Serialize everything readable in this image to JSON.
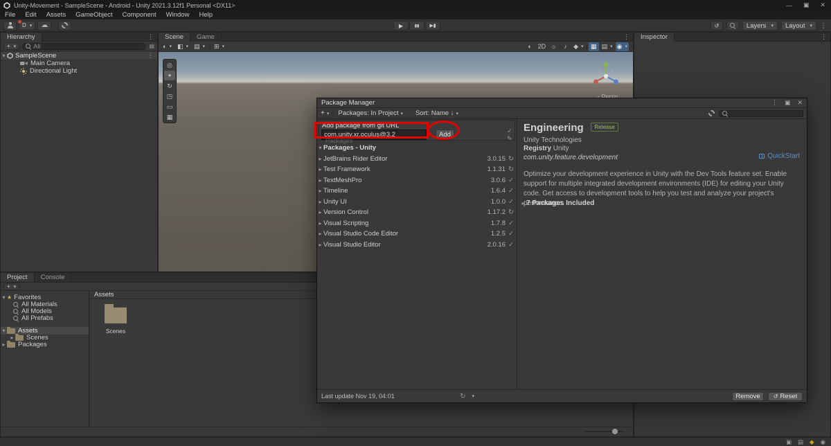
{
  "colors": {
    "annotation_red": "#e40000",
    "link_blue": "#5a8fc7",
    "release_green": "#9cc069",
    "panel_bg": "#383838",
    "chrome_dark": "#191919"
  },
  "icons": {
    "caret_down": "▾",
    "fold_open": "▾",
    "fold_closed": "▸",
    "check": "✓",
    "update": "↻",
    "close": "✕",
    "more": "⋮",
    "menu": "≡",
    "minimize": "—",
    "maximize": "▣",
    "play": "▶",
    "pause": "▮▮",
    "step": "▶▮",
    "undo_history": "↺",
    "refresh": "↻",
    "star": "★",
    "cloud": "☁",
    "plus": "+",
    "back": "‹",
    "pen": "✎",
    "sphere": "◐",
    "half": "◧",
    "rows": "▤",
    "grid": "▦",
    "grid2": "⊞",
    "light": "☼",
    "audio": "♪",
    "fx": "◆",
    "gizmo": "◉"
  },
  "title_bar": {
    "title": "Unity-Movement - SampleScene - Android - Unity 2021.3.12f1 Personal <DX11>"
  },
  "menu_bar": {
    "items": [
      "File",
      "Edit",
      "Assets",
      "GameObject",
      "Component",
      "Window",
      "Help"
    ]
  },
  "toolbar": {
    "account": "D",
    "layers": "Layers",
    "layout": "Layout"
  },
  "hierarchy": {
    "title": "Hierarchy",
    "search_scope": "All",
    "scene_name": "SampleScene",
    "items": [
      {
        "label": "Main Camera"
      },
      {
        "label": "Directional Light"
      }
    ]
  },
  "scene_view": {
    "tab_scene": "Scene",
    "tab_game": "Game",
    "badge_2d": "2D",
    "persp_label": "Persp",
    "tools": [
      "◎",
      "+",
      "↻",
      "◳",
      "▭",
      "▦"
    ]
  },
  "inspector": {
    "title": "Inspector"
  },
  "project": {
    "tab_project": "Project",
    "tab_console": "Console",
    "favorites_label": "Favorites",
    "favorites": [
      {
        "label": "All Materials"
      },
      {
        "label": "All Models"
      },
      {
        "label": "All Prefabs"
      }
    ],
    "assets_label": "Assets",
    "scenes_label": "Scenes",
    "packages_label": "Packages",
    "breadcrumb": "Assets",
    "folder_label": "Scenes"
  },
  "package_manager": {
    "title": "Package Manager",
    "filter_label": "Packages: In Project",
    "sort_label": "Sort: Name ↓",
    "add_popup": {
      "label": "Add package from git URL",
      "value": "com.unity.xr.oculus@3.2",
      "button": "Add"
    },
    "dim_section": "Packages",
    "section_header": "Packages - Unity",
    "packages": [
      {
        "name": "JetBrains Rider Editor",
        "version": "3.0.15",
        "status_icon": "↻"
      },
      {
        "name": "Test Framework",
        "version": "1.1.31",
        "status_icon": "↻"
      },
      {
        "name": "TextMeshPro",
        "version": "3.0.6",
        "status_icon": "✓"
      },
      {
        "name": "Timeline",
        "version": "1.6.4",
        "status_icon": "✓"
      },
      {
        "name": "Unity UI",
        "version": "1.0.0",
        "status_icon": "✓"
      },
      {
        "name": "Version Control",
        "version": "1.17.2",
        "status_icon": "↻"
      },
      {
        "name": "Visual Scripting",
        "version": "1.7.8",
        "status_icon": "✓"
      },
      {
        "name": "Visual Studio Code Editor",
        "version": "1.2.5",
        "status_icon": "✓"
      },
      {
        "name": "Visual Studio Editor",
        "version": "2.0.16",
        "status_icon": "✓"
      }
    ],
    "details": {
      "title": "Engineering",
      "badge": "Release",
      "author": "Unity Technologies",
      "registry_label": "Registry",
      "registry_value": "Unity",
      "package_id": "com.unity.feature.development",
      "quickstart": "QuickStart",
      "description": "Optimize your development experience in Unity with the Dev Tools feature set. Enable support for multiple integrated development environments (IDE) for editing your Unity code. Get access to development tools to help you test and analyze your project's performance.",
      "packages_included": "7 Packages Included"
    },
    "footer": {
      "last_update": "Last update Nov 19, 04:01",
      "remove": "Remove",
      "reset": "Reset"
    }
  }
}
